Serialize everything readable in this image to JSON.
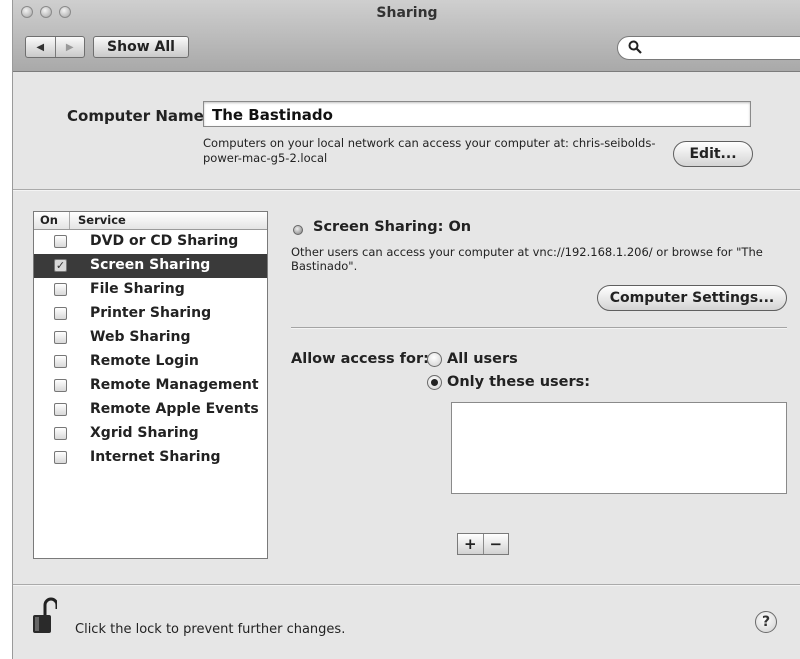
{
  "window": {
    "title": "Sharing"
  },
  "toolbar": {
    "back_icon": "◀",
    "forward_icon": "▶",
    "show_all_label": "Show All",
    "search_icon": "🔍"
  },
  "computer_name": {
    "label": "Computer Name:",
    "value": "The Bastinado",
    "help_text": "Computers on your local network can access your computer at: chris-seibolds-power-mac-g5-2.local",
    "edit_label": "Edit..."
  },
  "services": {
    "header_on": "On",
    "header_service": "Service",
    "items": [
      {
        "label": "DVD or CD Sharing",
        "checked": false,
        "selected": false
      },
      {
        "label": "Screen Sharing",
        "checked": true,
        "selected": true
      },
      {
        "label": "File Sharing",
        "checked": false,
        "selected": false
      },
      {
        "label": "Printer Sharing",
        "checked": false,
        "selected": false
      },
      {
        "label": "Web Sharing",
        "checked": false,
        "selected": false
      },
      {
        "label": "Remote Login",
        "checked": false,
        "selected": false
      },
      {
        "label": "Remote Management",
        "checked": false,
        "selected": false
      },
      {
        "label": "Remote Apple Events",
        "checked": false,
        "selected": false
      },
      {
        "label": "Xgrid Sharing",
        "checked": false,
        "selected": false
      },
      {
        "label": "Internet Sharing",
        "checked": false,
        "selected": false
      }
    ]
  },
  "detail": {
    "status_title": "Screen Sharing: On",
    "status_description": "Other users can access your computer at vnc://192.168.1.206/ or browse for \"The Bastinado\".",
    "computer_settings_label": "Computer Settings...",
    "allow_access_label": "Allow access for:",
    "option_all_users": "All users",
    "option_only_these": "Only these users:",
    "selected_option": "only_these",
    "add_label": "+",
    "remove_label": "−"
  },
  "footer": {
    "lock_text": "Click the lock to prevent further changes.",
    "help_label": "?"
  }
}
